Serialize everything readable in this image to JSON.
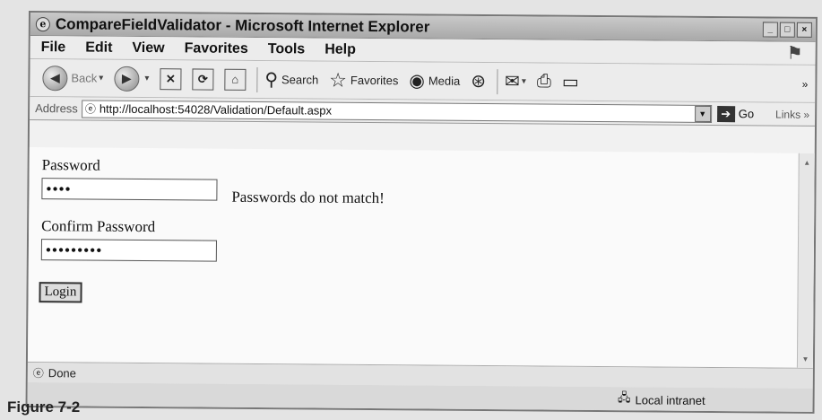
{
  "window": {
    "title": "CompareFieldValidator - Microsoft Internet Explorer",
    "title_icon": "e"
  },
  "menu": {
    "items": [
      {
        "first": "F",
        "rest": "ile"
      },
      {
        "first": "E",
        "rest": "dit"
      },
      {
        "first": "V",
        "rest": "iew"
      },
      {
        "first": "",
        "rest": "Favorites",
        "accel": "a"
      },
      {
        "first": "T",
        "rest": "ools"
      },
      {
        "first": "H",
        "rest": "elp"
      }
    ],
    "file": "File",
    "edit": "Edit",
    "view": "View",
    "favorites": "Favorites",
    "tools": "Tools",
    "help": "Help"
  },
  "toolbar": {
    "back": "Back",
    "search": "Search",
    "favorites": "Favorites",
    "media": "Media"
  },
  "address": {
    "label": "Address",
    "url": "http://localhost:54028/Validation/Default.aspx",
    "go": "Go",
    "links": "Links"
  },
  "form": {
    "password_label": "Password",
    "password_mask": "●●●●",
    "error_message": "Passwords do not match!",
    "confirm_label": "Confirm Password",
    "confirm_mask": "●●●●●●●●●",
    "login_label": "Login"
  },
  "status": {
    "text": "Done",
    "zone": "Local intranet"
  },
  "caption": "Figure 7-2",
  "icons": {
    "page": "ie-page-icon",
    "back": "back-arrow-icon",
    "forward": "forward-arrow-icon",
    "stop": "stop-icon",
    "refresh": "refresh-icon",
    "home": "home-icon",
    "search": "search-icon",
    "favorites": "favorites-star-icon",
    "media": "media-icon",
    "history": "history-icon",
    "mail": "mail-icon",
    "print": "print-icon",
    "edit": "edit-icon"
  }
}
